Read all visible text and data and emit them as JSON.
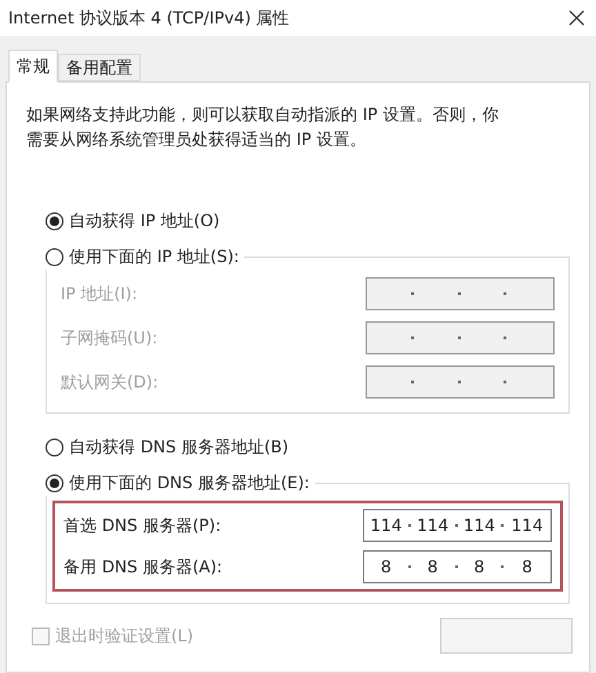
{
  "window": {
    "title": "Internet 协议版本 4 (TCP/IPv4) 属性"
  },
  "tabs": [
    {
      "label": "常规",
      "selected": true
    },
    {
      "label": "备用配置",
      "selected": false
    }
  ],
  "description": "如果网络支持此功能，则可以获取自动指派的 IP 设置。否则，你需要从网络系统管理员处获得适当的 IP 设置。",
  "ip_options": [
    {
      "label": "自动获得 IP 地址(O)",
      "selected": true
    },
    {
      "label": "使用下面的 IP 地址(S):",
      "selected": false
    }
  ],
  "ip_fields": [
    {
      "label": "IP 地址(I):",
      "disabled": true
    },
    {
      "label": "子网掩码(U):",
      "disabled": true
    },
    {
      "label": "默认网关(D):",
      "disabled": true
    }
  ],
  "dns_options": [
    {
      "label": "自动获得 DNS 服务器地址(B)",
      "selected": false
    },
    {
      "label": "使用下面的 DNS 服务器地址(E):",
      "selected": true
    }
  ],
  "dns_highlighted": true,
  "dns_fields": [
    {
      "label": "首选 DNS 服务器(P):",
      "octets": [
        "114",
        "114",
        "114",
        "114"
      ]
    },
    {
      "label": "备用 DNS 服务器(A):",
      "octets": [
        "8",
        "8",
        "8",
        "8"
      ]
    }
  ],
  "validate": {
    "label": "退出时验证设置(L)",
    "checked": false,
    "disabled": true
  }
}
